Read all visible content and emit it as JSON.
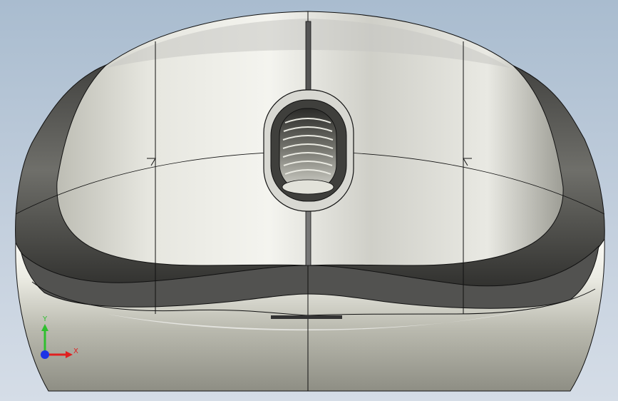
{
  "viewport": {
    "background_top": "#a9bccf",
    "background_bottom": "#d5dde7",
    "model": "computer-mouse-front-view",
    "edge_color": "#111111"
  },
  "triad": {
    "y_label": "Y",
    "x_label": "X",
    "y_color": "#2fbf2f",
    "x_color": "#e02020",
    "z_color": "#1d34e6"
  }
}
